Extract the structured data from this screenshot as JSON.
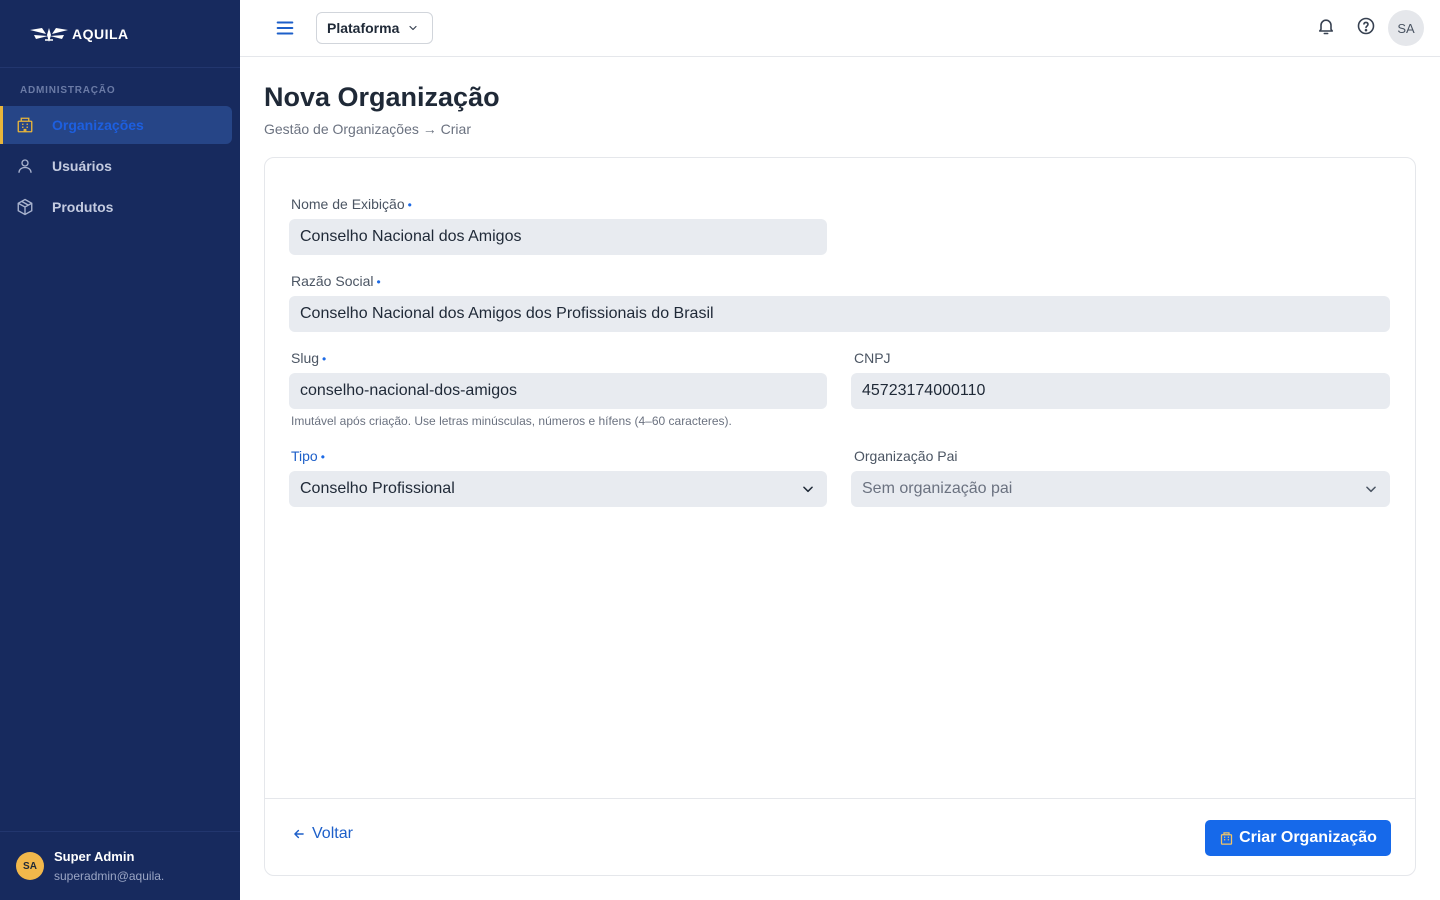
{
  "brand": {
    "name": "AQUILA"
  },
  "sidebar": {
    "section_label": "ADMINISTRAÇÃO",
    "items": [
      {
        "label": "Organizações",
        "icon": "building-icon",
        "active": true
      },
      {
        "label": "Usuários",
        "icon": "user-icon",
        "active": false
      },
      {
        "label": "Produtos",
        "icon": "box-icon",
        "active": false
      }
    ],
    "user": {
      "initials": "SA",
      "name": "Super Admin",
      "email": "superadmin@aquila."
    }
  },
  "topbar": {
    "platform_select": "Plataforma",
    "avatar_initials": "SA"
  },
  "page": {
    "title": "Nova Organização",
    "breadcrumb": "Gestão de Organizações → Criar"
  },
  "form": {
    "display_name": {
      "label": "Nome de Exibição",
      "required_mark": "•",
      "value": "Conselho Nacional dos Amigos"
    },
    "legal_name": {
      "label": "Razão Social",
      "required_mark": "•",
      "value": "Conselho Nacional dos Amigos dos Profissionais do Brasil"
    },
    "slug": {
      "label": "Slug",
      "required_mark": "•",
      "value": "conselho-nacional-dos-amigos",
      "hint": "Imutável após criação. Use letras minúsculas, números e hífens (4–60 caracteres)."
    },
    "cnpj": {
      "label": "CNPJ",
      "value": "45723174000110"
    },
    "type": {
      "label": "Tipo",
      "required_mark": "•",
      "value": "Conselho Profissional"
    },
    "parent": {
      "label": "Organização Pai",
      "placeholder": "Sem organização pai"
    }
  },
  "actions": {
    "back_label": "Voltar",
    "submit_label": "Criar Organização"
  },
  "colors": {
    "sidebar_bg": "#172a5e",
    "accent": "#1669ea",
    "active_marker": "#e8b53b"
  }
}
